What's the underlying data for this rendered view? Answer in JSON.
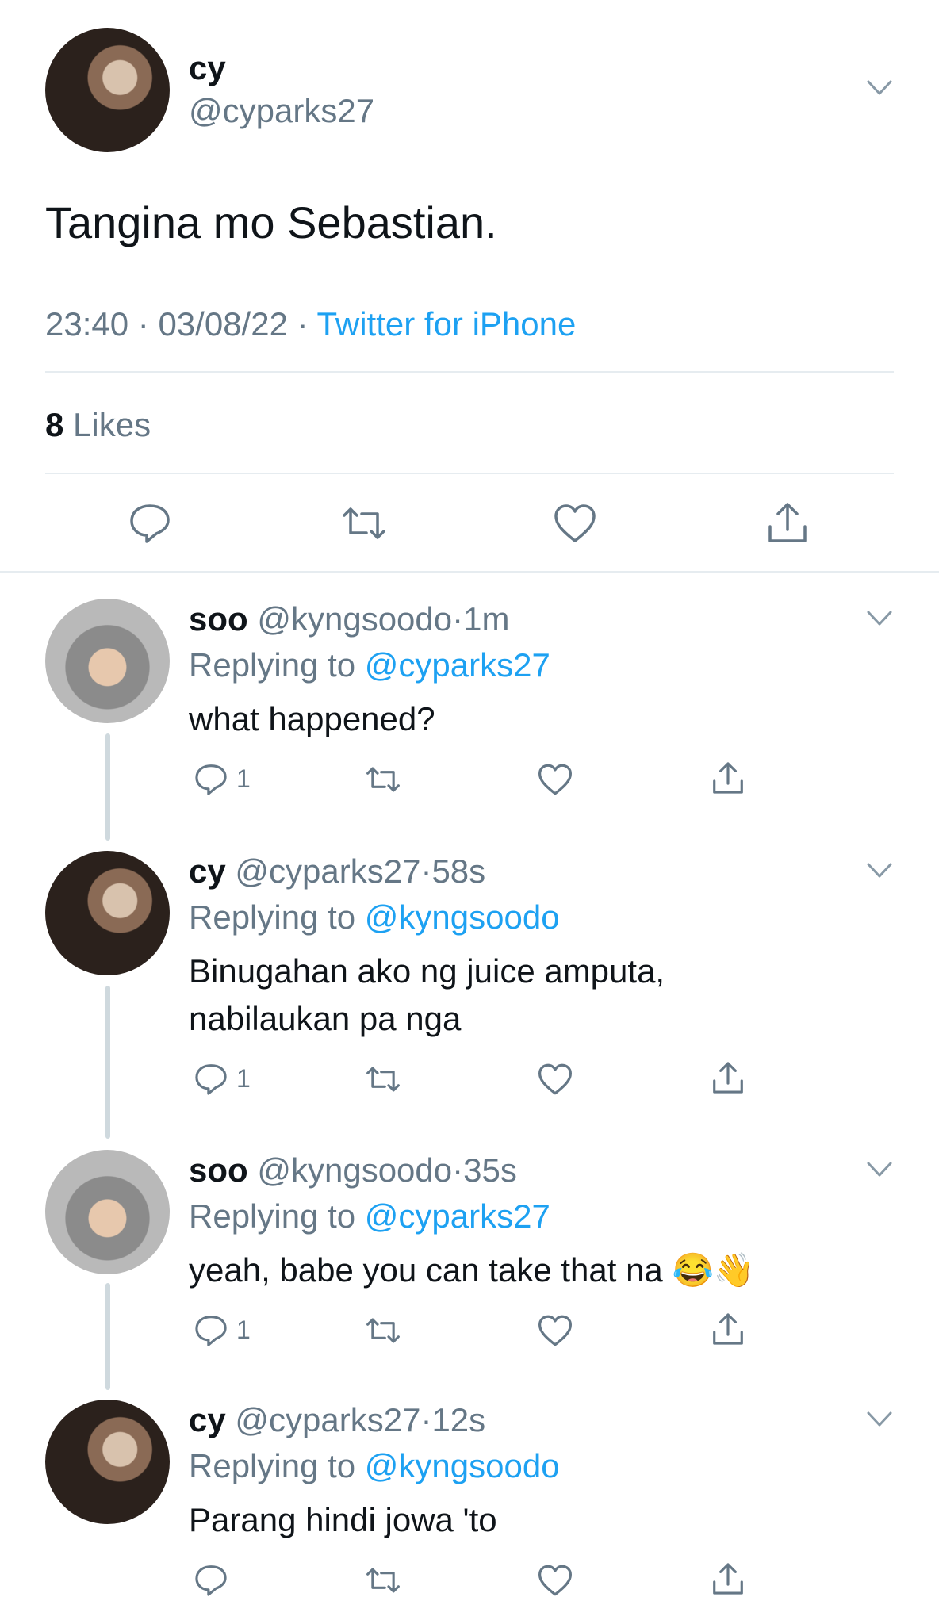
{
  "main_tweet": {
    "display_name": "cy",
    "handle": "@cyparks27",
    "text": "Tangina mo Sebastian.",
    "time": "23:40",
    "date": "03/08/22",
    "separator": "·",
    "source": "Twitter for iPhone",
    "likes_count": "8",
    "likes_label": "Likes"
  },
  "replies": [
    {
      "display_name": "soo",
      "handle": "@kyngsoodo",
      "time": "1m",
      "replying_prefix": "Replying to",
      "replying_to": "@cyparks27",
      "text_lines": [
        "what happened?"
      ],
      "reply_count": "1"
    },
    {
      "display_name": "cy",
      "handle": "@cyparks27",
      "time": "58s",
      "replying_prefix": "Replying to",
      "replying_to": "@kyngsoodo",
      "text_lines": [
        "Binugahan ako ng juice amputa,",
        "nabilaukan pa nga"
      ],
      "reply_count": "1"
    },
    {
      "display_name": "soo",
      "handle": "@kyngsoodo",
      "time": "35s",
      "replying_prefix": "Replying to",
      "replying_to": "@cyparks27",
      "text_lines": [
        "yeah, babe you can take that na 😂👋"
      ],
      "reply_count": "1"
    },
    {
      "display_name": "cy",
      "handle": "@cyparks27",
      "time": "12s",
      "replying_prefix": "Replying to",
      "replying_to": "@kyngsoodo",
      "text_lines": [
        "Parang hindi jowa 'to"
      ],
      "reply_count": ""
    }
  ],
  "icons": [
    "reply-icon",
    "retweet-icon",
    "like-icon",
    "share-icon",
    "chevron-down-icon"
  ],
  "colors": {
    "link": "#1da1f2",
    "muted": "#657786",
    "divider": "#e6ecf0"
  }
}
